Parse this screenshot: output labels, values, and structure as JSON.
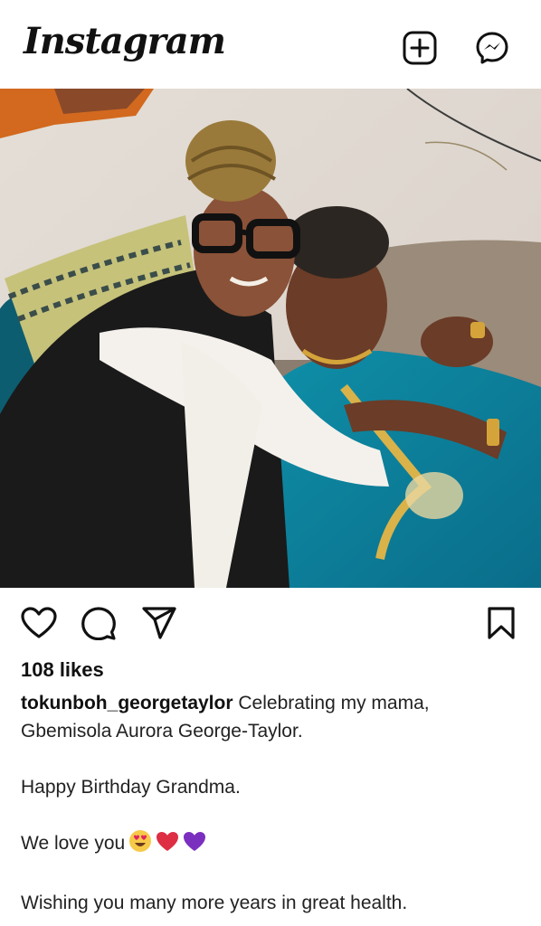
{
  "header": {
    "logo_text": "Instagram",
    "new_post_icon": "plus-square-icon",
    "messenger_icon": "messenger-icon"
  },
  "post": {
    "actions": {
      "like_icon": "heart-icon",
      "comment_icon": "comment-icon",
      "share_icon": "paper-plane-icon",
      "save_icon": "bookmark-icon"
    },
    "likes": "108 likes",
    "username": "tokunboh_georgetaylor",
    "caption_first": "Celebrating my mama,",
    "caption_second": "Gbemisola Aurora George-Taylor.",
    "caption_birthday": "Happy Birthday Grandma.",
    "caption_love": "We love you",
    "caption_emojis": [
      "heart-eyes-emoji",
      "red-heart-emoji",
      "purple-heart-emoji"
    ],
    "caption_wish": "Wishing you many more years in great health."
  }
}
